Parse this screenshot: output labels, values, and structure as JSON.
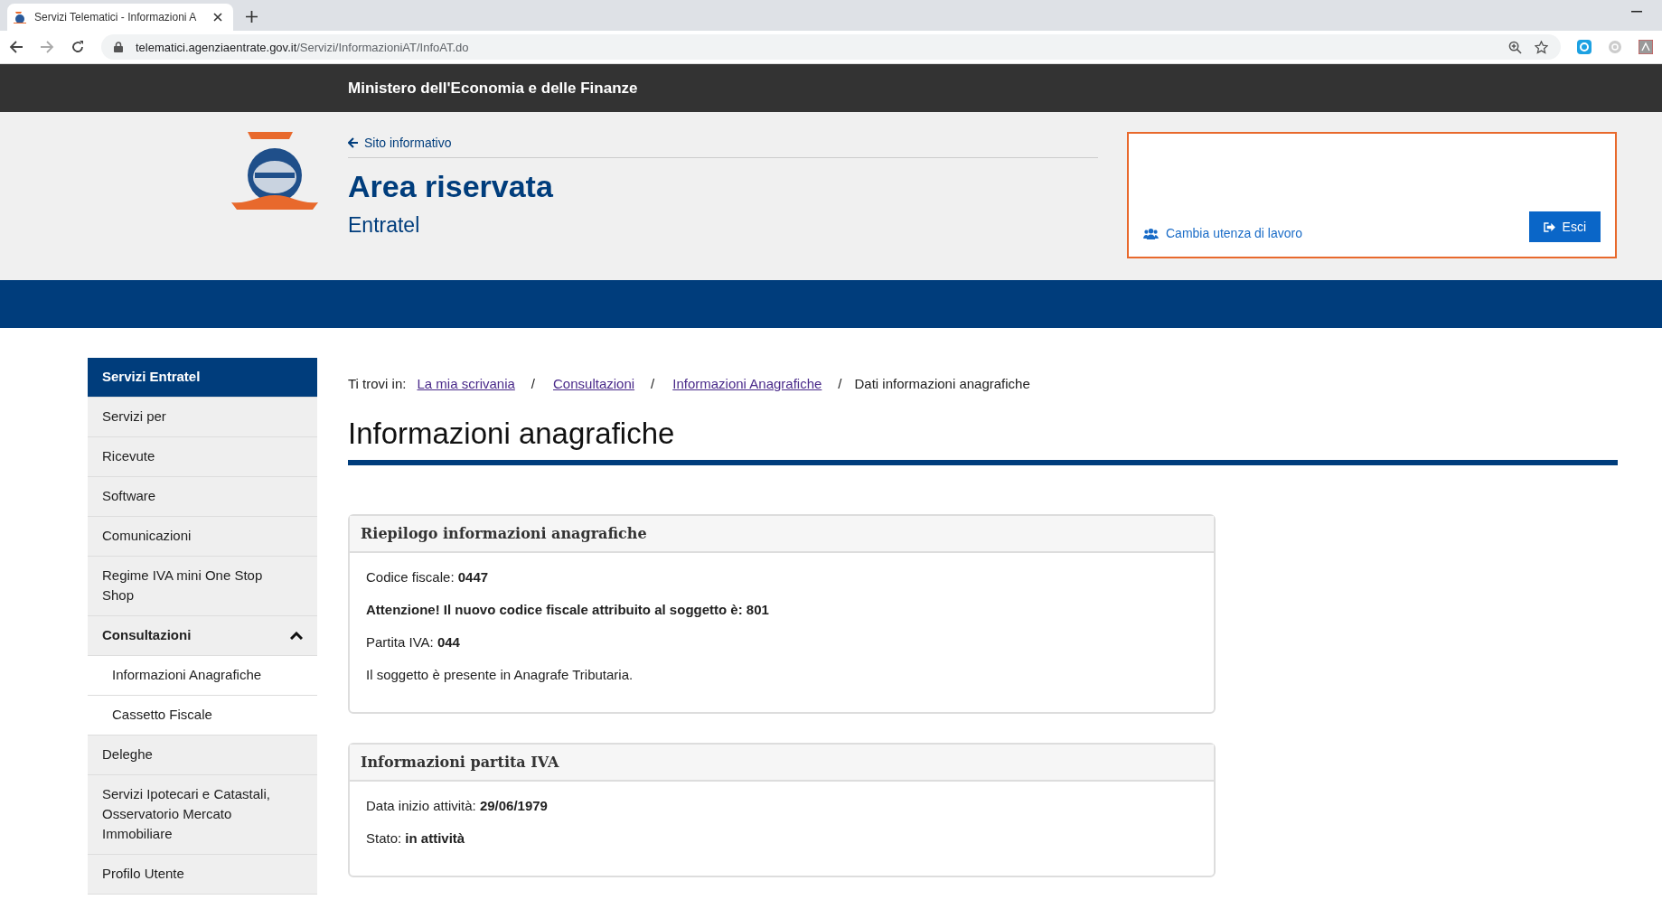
{
  "browser": {
    "tab_title": "Servizi Telematici - Informazioni A",
    "url_host": "telematici.agenziaentrate.gov.it",
    "url_path": "/Servizi/InformazioniAT/InfoAT.do"
  },
  "ministry_bar": {
    "title": "Ministero dell'Economia e delle Finanze"
  },
  "header": {
    "back_link": "Sito informativo",
    "title": "Area riservata",
    "subtitle": "Entratel",
    "user_box": {
      "change_link": "Cambia utenza di lavoro",
      "logout_button": "Esci"
    }
  },
  "sidebar": {
    "items": [
      {
        "kind": "header",
        "label": "Servizi Entratel"
      },
      {
        "kind": "item",
        "label": "Servizi per"
      },
      {
        "kind": "item",
        "label": "Ricevute"
      },
      {
        "kind": "item",
        "label": "Software"
      },
      {
        "kind": "item",
        "label": "Comunicazioni"
      },
      {
        "kind": "item",
        "label": "Regime IVA mini One Stop Shop"
      },
      {
        "kind": "group",
        "label": "Consultazioni",
        "expanded": true,
        "children": [
          {
            "label": "Informazioni Anagrafiche"
          },
          {
            "label": "Cassetto Fiscale"
          }
        ]
      },
      {
        "kind": "item",
        "label": "Deleghe"
      },
      {
        "kind": "item",
        "label": "Servizi Ipotecari e Catastali, Osservatorio Mercato Immobiliare"
      },
      {
        "kind": "item",
        "label": "Profilo Utente"
      }
    ]
  },
  "breadcrumb": {
    "prefix": "Ti trovi in:",
    "separator": "/",
    "links": [
      "La mia scrivania",
      "Consultazioni",
      "Informazioni Anagrafiche"
    ],
    "current": "Dati informazioni anagrafiche"
  },
  "page_title": "Informazioni anagrafiche",
  "cards": [
    {
      "title": "Riepilogo informazioni anagrafiche",
      "lines": [
        "Codice fiscale: **0447**",
        "**Attenzione! Il nuovo codice fiscale attribuito al soggetto è: 801**",
        "Partita IVA: **044**",
        "Il soggetto è presente in Anagrafe Tributaria."
      ]
    },
    {
      "title": "Informazioni partita IVA",
      "lines": [
        "Data inizio attività: **29/06/1979**",
        "Stato: **in attività**"
      ]
    }
  ]
}
